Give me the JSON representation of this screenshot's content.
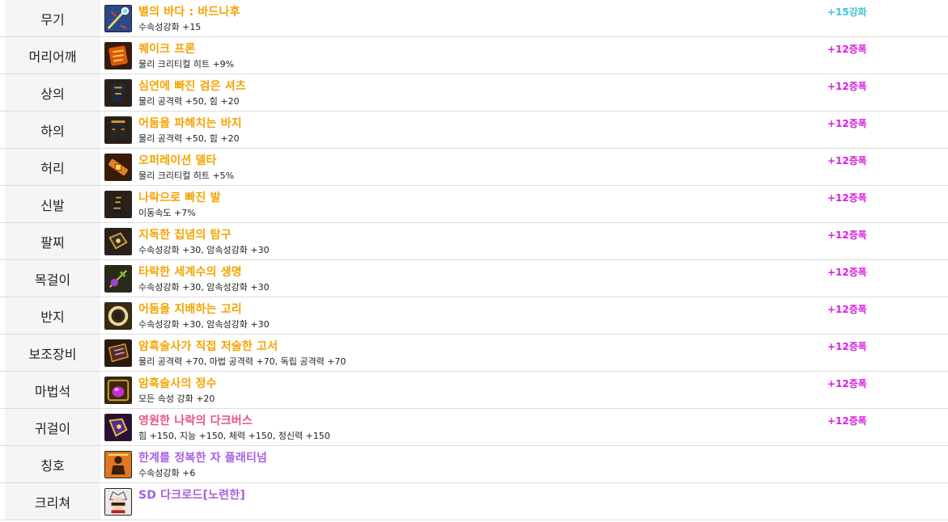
{
  "colors": {
    "epic_name": "#f5a300",
    "legendary_name": "#e8508a",
    "title_name": "#a660e0",
    "enhance": "#3ec5d8",
    "amplify": "#d81ee0"
  },
  "rows": [
    {
      "slot": "무기",
      "name": "별의 바다 : 바드나후",
      "stats": "수속성강화 +15",
      "upgrade": "+15강화",
      "icon": "staff-icon"
    },
    {
      "slot": "머리어깨",
      "name": "퀘이크 프론",
      "stats": "물리 크리티컬 히트 +9%",
      "upgrade": "+12증폭",
      "icon": "shoulder-armor-icon"
    },
    {
      "slot": "상의",
      "name": "심연에 빠진 검은 셔츠",
      "stats": "물리 공격력 +50, 힘 +20",
      "upgrade": "+12증폭",
      "icon": "shirt-icon"
    },
    {
      "slot": "하의",
      "name": "어둠을 파헤치는 바지",
      "stats": "물리 공격력 +50, 힘 +20",
      "upgrade": "+12증폭",
      "icon": "pants-icon"
    },
    {
      "slot": "허리",
      "name": "오퍼레이션 델타",
      "stats": "물리 크리티컬 히트 +5%",
      "upgrade": "+12증폭",
      "icon": "belt-icon"
    },
    {
      "slot": "신발",
      "name": "나락으로 빠진 발",
      "stats": "이동속도 +7%",
      "upgrade": "+12증폭",
      "icon": "boots-icon"
    },
    {
      "slot": "팔찌",
      "name": "지독한 집념의 탐구",
      "stats": "수속성강화 +30, 암속성강화 +30",
      "upgrade": "+12증폭",
      "icon": "bracelet-icon"
    },
    {
      "slot": "목걸이",
      "name": "타락한 세계수의 생명",
      "stats": "수속성강화 +30, 암속성강화 +30",
      "upgrade": "+12증폭",
      "icon": "necklace-icon"
    },
    {
      "slot": "반지",
      "name": "어둠을 지배하는 고리",
      "stats": "수속성강화 +30, 암속성강화 +30",
      "upgrade": "+12증폭",
      "icon": "ring-icon"
    },
    {
      "slot": "보조장비",
      "name": "암흑술사가 직접 저술한 고서",
      "stats": "물리 공격력 +70, 마법 공격력 +70, 독립 공격력 +70",
      "upgrade": "+12증폭",
      "icon": "book-icon"
    },
    {
      "slot": "마법석",
      "name": "암흑술사의 정수",
      "stats": "모든 속성 강화 +20",
      "upgrade": "+12증폭",
      "icon": "magic-stone-icon"
    },
    {
      "slot": "귀걸이",
      "name": "영원한 나락의 다크버스",
      "stats": "힘 +150, 지능 +150, 체력 +150, 정신력 +150",
      "upgrade": "+12증폭",
      "icon": "earring-icon"
    },
    {
      "slot": "칭호",
      "name": "한계를 정복한 자 플래티넘",
      "stats": "수속성강화 +6",
      "upgrade": "",
      "icon": "title-icon"
    },
    {
      "slot": "크리쳐",
      "name": "SD 다크로드[노련한]",
      "stats": "",
      "upgrade": "",
      "icon": "creature-icon"
    }
  ]
}
